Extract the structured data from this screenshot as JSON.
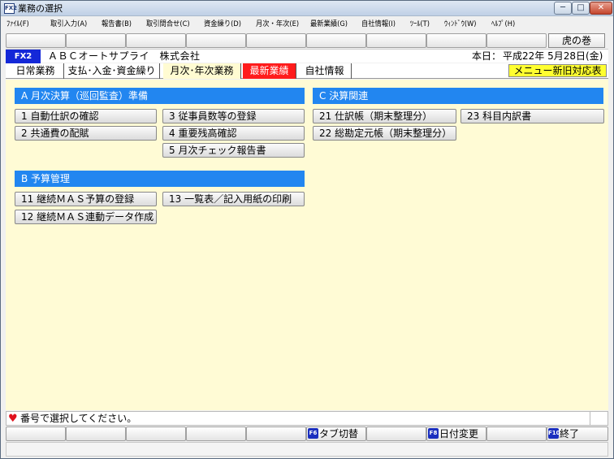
{
  "window": {
    "title": "業務の選択",
    "app_icon": "FX2",
    "min_glyph": "─",
    "max_glyph": "□",
    "close_glyph": "✕"
  },
  "menu": [
    {
      "label": "ﾌｧｲﾙ(F)"
    },
    {
      "label": "取引入力(A)"
    },
    {
      "label": "報告書(B)"
    },
    {
      "label": "取引問合せ(C)"
    },
    {
      "label": "資金繰り(D)"
    },
    {
      "label": "月次・年次(E)"
    },
    {
      "label": "最新業績(G)"
    },
    {
      "label": "自社情報(I)"
    },
    {
      "label": "ﾂｰﾙ(T)"
    },
    {
      "label": "ｳｨﾝﾄﾞｳ(W)"
    },
    {
      "label": "ﾍﾙﾌﾟ(H)"
    }
  ],
  "tora_button": "虎の巻",
  "company": {
    "badge": "FX2",
    "name": "ＡＢＣオートサプライ　株式会社",
    "today_label": "本日：",
    "today_date": "平成22年  5月28日(金)"
  },
  "tabs": [
    {
      "label": "日常業務"
    },
    {
      "label": "支払･入金･資金繰り"
    },
    {
      "label": "月次･年次業務"
    },
    {
      "label": "最新業績"
    },
    {
      "label": "自社情報"
    }
  ],
  "menu_notice": "メニュー新旧対応表",
  "sections": {
    "a": {
      "title": "A  月次決算（巡回監査）準備",
      "items": [
        "1 自動仕訳の確認",
        "2 共通費の配賦",
        "3 従事員数等の登録",
        "4 重要残高確認",
        "5 月次チェック報告書"
      ]
    },
    "b": {
      "title": "B  予算管理",
      "items": [
        "11 継続ＭＡＳ予算の登録",
        "12 継続ＭＡＳ連動データ作成",
        "13 一覧表／記入用紙の印刷"
      ]
    },
    "c": {
      "title": "C  決算関連",
      "items": [
        "21 仕訳帳（期末整理分）",
        "22 総勘定元帳（期末整理分）",
        "23 科目内訳書"
      ]
    }
  },
  "status": {
    "message": "番号で選択してください。",
    "heart_glyph": "♥"
  },
  "fkeys_bottom": [
    {
      "key": "F6",
      "label": "タブ切替"
    },
    {
      "key": "F8",
      "label": "日付変更"
    },
    {
      "key": "F10",
      "label": "終了"
    }
  ],
  "colors": {
    "accent_blue": "#2286f0",
    "active_tab_red": "#ff1c1c",
    "notice_yellow": "#ffff30",
    "content_bg": "#fffbd5",
    "badge_blue": "#1428d8"
  }
}
